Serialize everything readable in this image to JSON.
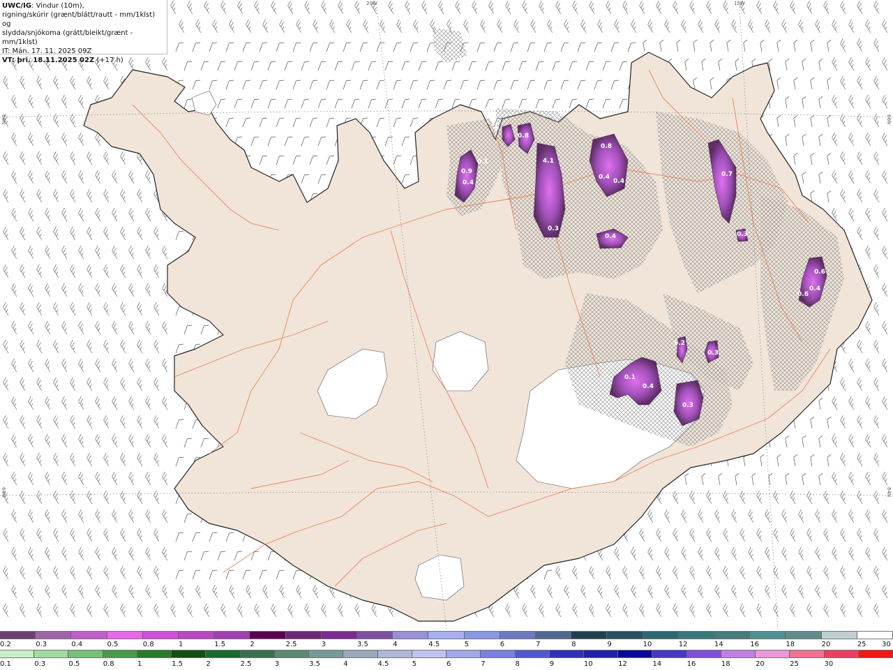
{
  "legend": {
    "title": "UWC/IG",
    "line1": ": Vindur (10m),",
    "line2": "rigning/skúrir (grænt/blátt/rautt - mm/1klst) og",
    "line3": "slydda/snjókoma (grátt/bleikt/grænt - mm/1klst)",
    "it_label": "IT: Mán. 17. 11. 2025 09Z",
    "vt_label": "VT: þri. 18.11.2025 02Z",
    "vt_offset": " (+17 h)"
  },
  "graticule": {
    "lon_20w": "20W",
    "lon_15w": "15W",
    "lat_66n_left": "66N",
    "lat_66n_right": "66N",
    "lat_64n_left": "64N",
    "lat_64n_right": "64N"
  },
  "colors": {
    "land": "#f1e5d9",
    "road": "#e8835a",
    "coast": "#222222",
    "glacier": "#ffffff",
    "barb": "#555555"
  },
  "precip_labels": [
    "0.9",
    "0.4",
    "0.1",
    "0.8",
    "4.1",
    "0.3",
    "0.8",
    "0.4",
    "0.4",
    "0.4",
    "0.7",
    "0.3",
    "0.6",
    "0.4",
    "0.6",
    "0.2",
    "0.3",
    "0.1",
    "0.4",
    "0.3"
  ],
  "snow_scale": {
    "colors": [
      "#6b4070",
      "#a064a8",
      "#c060c8",
      "#e868ea",
      "#d050d8",
      "#b848c0",
      "#a040b0",
      "#5a0050",
      "#6a2878",
      "#7a2c90",
      "#8050a0",
      "#9a90d8",
      "#a8aff0",
      "#8898e0",
      "#7078c0",
      "#506890",
      "#204050",
      "#285060",
      "#306870",
      "#3a7878",
      "#467c7c",
      "#509090",
      "#608c8c",
      "#c0d0d0",
      "#ffffff"
    ],
    "ticks": [
      "0.2",
      "0.3",
      "0.4",
      "0.5",
      "0.8",
      "1",
      "1.5",
      "2",
      "2.5",
      "3",
      "3.5",
      "4",
      "4.5",
      "5",
      "6",
      "7",
      "8",
      "9",
      "10",
      "12",
      "14",
      "16",
      "18",
      "20",
      "25",
      "30"
    ]
  },
  "rain_scale": {
    "colors": [
      "#c8f0c8",
      "#a0dca0",
      "#78c078",
      "#4a9a4a",
      "#2a7a2a",
      "#105010",
      "#1a6a30",
      "#3a7050",
      "#5a8870",
      "#7a9898",
      "#98a8b8",
      "#b0b8d8",
      "#c0c4ec",
      "#a0a8e8",
      "#7a80e0",
      "#5058d0",
      "#3030b8",
      "#2020a8",
      "#0a0a98",
      "#4838c0",
      "#8050d8",
      "#c080e0",
      "#e898d8",
      "#f07090",
      "#e84060",
      "#f01818"
    ],
    "ticks": [
      "0.1",
      "0.3",
      "0.5",
      "0.8",
      "1",
      "1.5",
      "2",
      "2.5",
      "3",
      "3.5",
      "4",
      "4.5",
      "5",
      "6",
      "7",
      "8",
      "9",
      "10",
      "12",
      "14",
      "16",
      "18",
      "20",
      "25",
      "30"
    ]
  }
}
